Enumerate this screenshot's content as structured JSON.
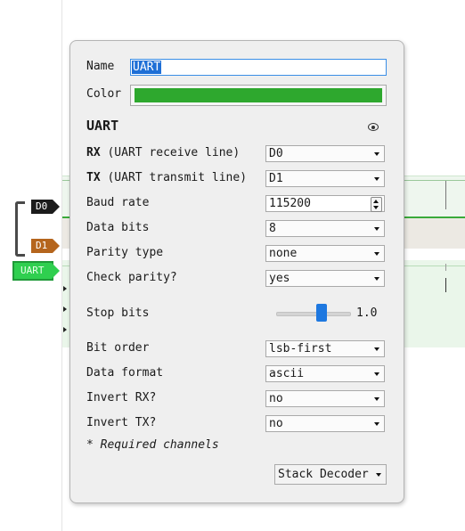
{
  "channels": {
    "d0_tag": "D0",
    "d1_tag": "D1",
    "uart_tag": "UART"
  },
  "popup": {
    "name_label": "Name",
    "name_value": "UART",
    "color_label": "Color",
    "color_value": "#2ea82e",
    "decoder_title": "UART",
    "visibility_icon": "eye-icon",
    "fields": {
      "rx": {
        "label_bold": "RX",
        "label_rest": " (UART receive line)",
        "value": "D0"
      },
      "tx": {
        "label_bold": "TX",
        "label_rest": " (UART transmit line)",
        "value": "D1"
      },
      "baud_rate": {
        "label": "Baud rate",
        "value": "115200"
      },
      "data_bits": {
        "label": "Data bits",
        "value": "8"
      },
      "parity_type": {
        "label": "Parity type",
        "value": "none"
      },
      "check_parity": {
        "label": "Check parity?",
        "value": "yes"
      },
      "stop_bits": {
        "label": "Stop bits",
        "value": "1.0",
        "slider_level": 0.5
      },
      "bit_order": {
        "label": "Bit order",
        "value": "lsb-first"
      },
      "data_format": {
        "label": "Data format",
        "value": "ascii"
      },
      "invert_rx": {
        "label": "Invert RX?",
        "value": "no"
      },
      "invert_tx": {
        "label": "Invert TX?",
        "value": "no"
      }
    },
    "required_note": "* Required channels",
    "stack_decoder_label": "Stack Decoder"
  }
}
